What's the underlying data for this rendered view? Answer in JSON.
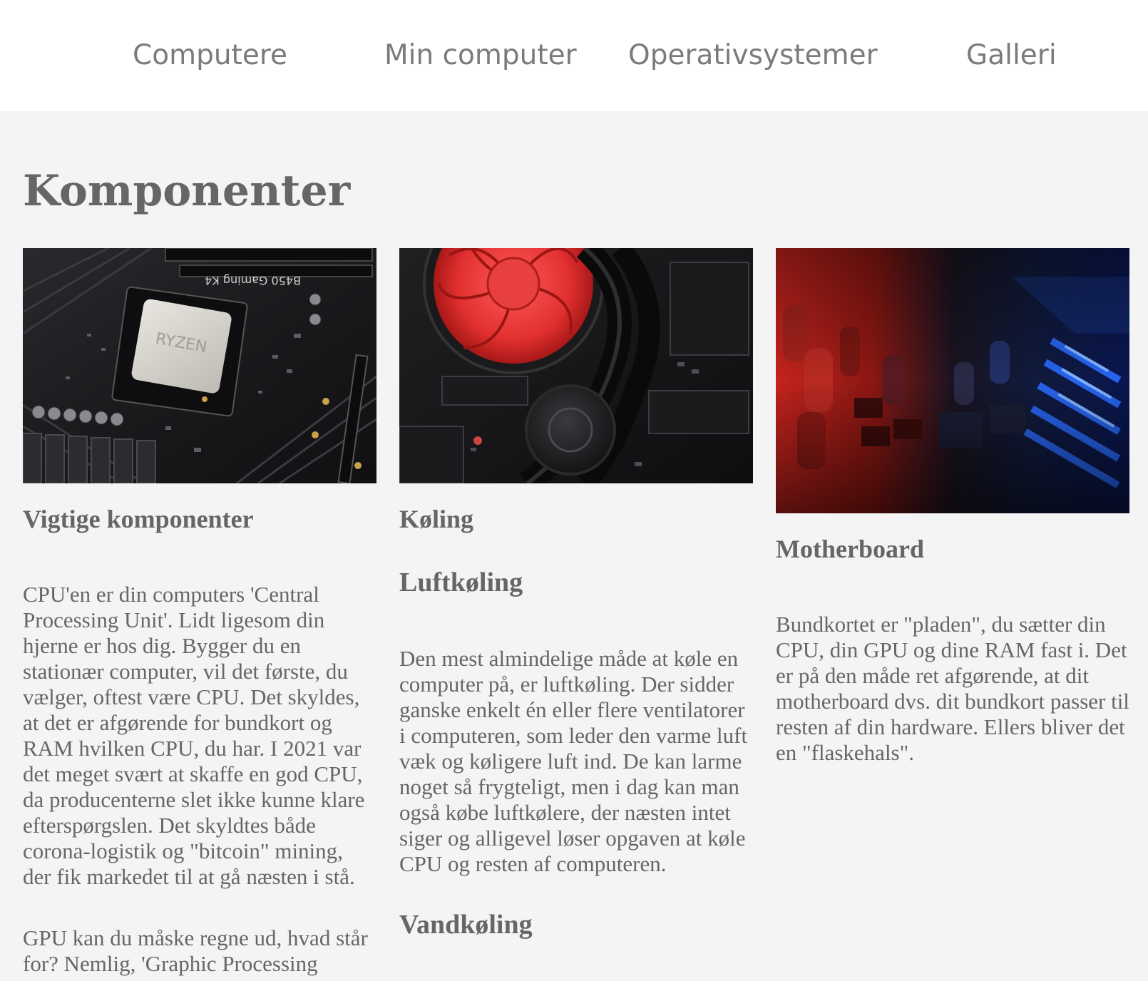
{
  "nav": {
    "items": [
      {
        "label": "Computere"
      },
      {
        "label": "Min computer"
      },
      {
        "label": "Operativsystemer"
      },
      {
        "label": "Galleri"
      }
    ]
  },
  "page": {
    "title": "Komponenter"
  },
  "columns": [
    {
      "image": "cpu-motherboard-image",
      "heading": "Vigtige komponenter",
      "paragraphs": [
        "CPU'en er din computers 'Central Processing Unit'. Lidt ligesom din hjerne er hos dig. Bygger du en stationær computer, vil det første, du vælger, oftest være CPU. Det skyldes, at det er afgørende for bundkort og RAM hvilken CPU, du har. I 2021 var det meget svært at skaffe en god CPU, da producenterne slet ikke kunne klare efterspørgslen. Det skyldtes både corona-logistik og \"bitcoin\" mining, der fik markedet til at gå næsten i stå.",
        "GPU kan du måske regne ud, hvad står for? Nemlig, 'Graphic Processing"
      ]
    },
    {
      "image": "cpu-cooler-fan-image",
      "heading": "Køling",
      "subheading": "Luftkøling",
      "paragraphs": [
        "Den mest almindelige måde at køle en computer på, er luftkøling. Der sidder ganske enkelt én eller flere ventilatorer i computeren, som leder den varme luft væk og køligere luft ind. De kan larme noget så frygteligt, men i dag kan man også købe luftkølere, der næsten intet siger og alligevel løser opgaven at køle CPU og resten af computeren."
      ],
      "subheading2": "Vandkøling"
    },
    {
      "image": "motherboard-closeup-image",
      "heading": "Motherboard",
      "paragraphs": [
        "Bundkortet er \"pladen\", du sætter din CPU, din GPU og dine RAM fast i. Det er på den måde ret afgørende, at dit motherboard dvs. dit bundkort passer til resten af din hardware. Ellers bliver det en \"flaskehals\"."
      ]
    }
  ]
}
